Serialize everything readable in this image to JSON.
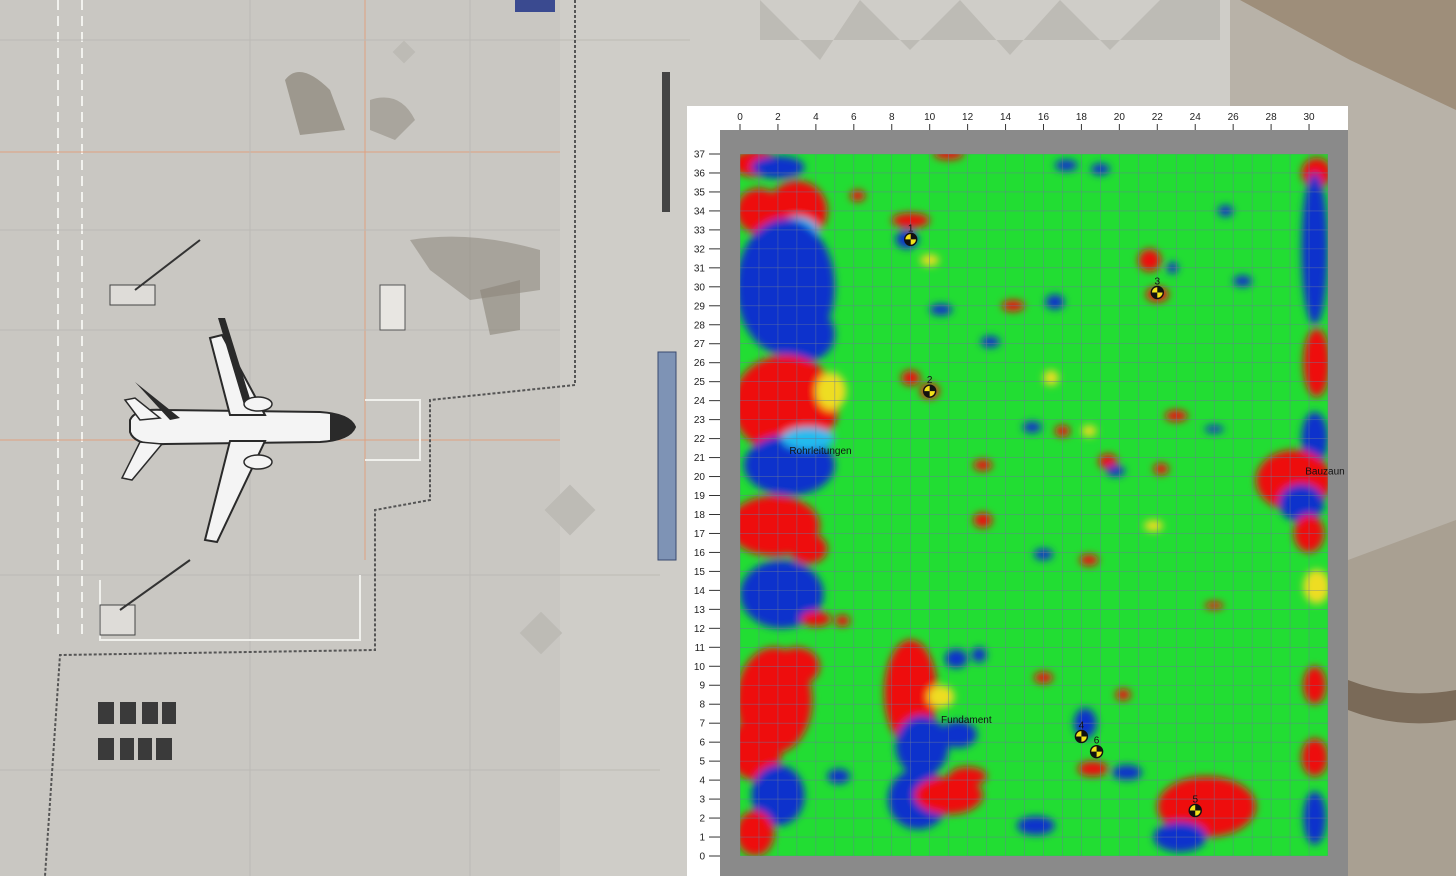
{
  "chart_data": {
    "type": "heatmap",
    "x_ticks": [
      "0",
      "2",
      "4",
      "6",
      "8",
      "10",
      "12",
      "14",
      "16",
      "18",
      "20",
      "22",
      "24",
      "26",
      "28",
      "30"
    ],
    "y_ticks": [
      "0",
      "1",
      "2",
      "3",
      "4",
      "5",
      "6",
      "7",
      "8",
      "9",
      "10",
      "11",
      "12",
      "13",
      "14",
      "15",
      "16",
      "17",
      "18",
      "19",
      "20",
      "21",
      "22",
      "23",
      "24",
      "25",
      "26",
      "27",
      "28",
      "29",
      "30",
      "31",
      "32",
      "33",
      "34",
      "35",
      "36",
      "37"
    ],
    "xlim": [
      0,
      31
    ],
    "ylim": [
      0,
      37
    ],
    "grid": true,
    "colors": {
      "background": "#22dd33",
      "high": "#ee1111",
      "low": "#1133cc",
      "mid_warm": "#eedd22",
      "mid_cool": "#22bbee"
    },
    "markers": [
      {
        "label": "1",
        "x": 9,
        "y": 32.5
      },
      {
        "label": "2",
        "x": 10,
        "y": 24.5
      },
      {
        "label": "3",
        "x": 22,
        "y": 29.7
      },
      {
        "label": "4",
        "x": 18,
        "y": 6.3
      },
      {
        "label": "5",
        "x": 24,
        "y": 2.4
      },
      {
        "label": "6",
        "x": 18.8,
        "y": 5.5
      }
    ],
    "annotations": [
      {
        "text": "Rohrleitungen",
        "x": 2.6,
        "y": 21.2
      },
      {
        "text": "Fundament",
        "x": 10.6,
        "y": 7
      },
      {
        "text": "Bauzaun",
        "x": 29.8,
        "y": 20.1
      }
    ]
  }
}
